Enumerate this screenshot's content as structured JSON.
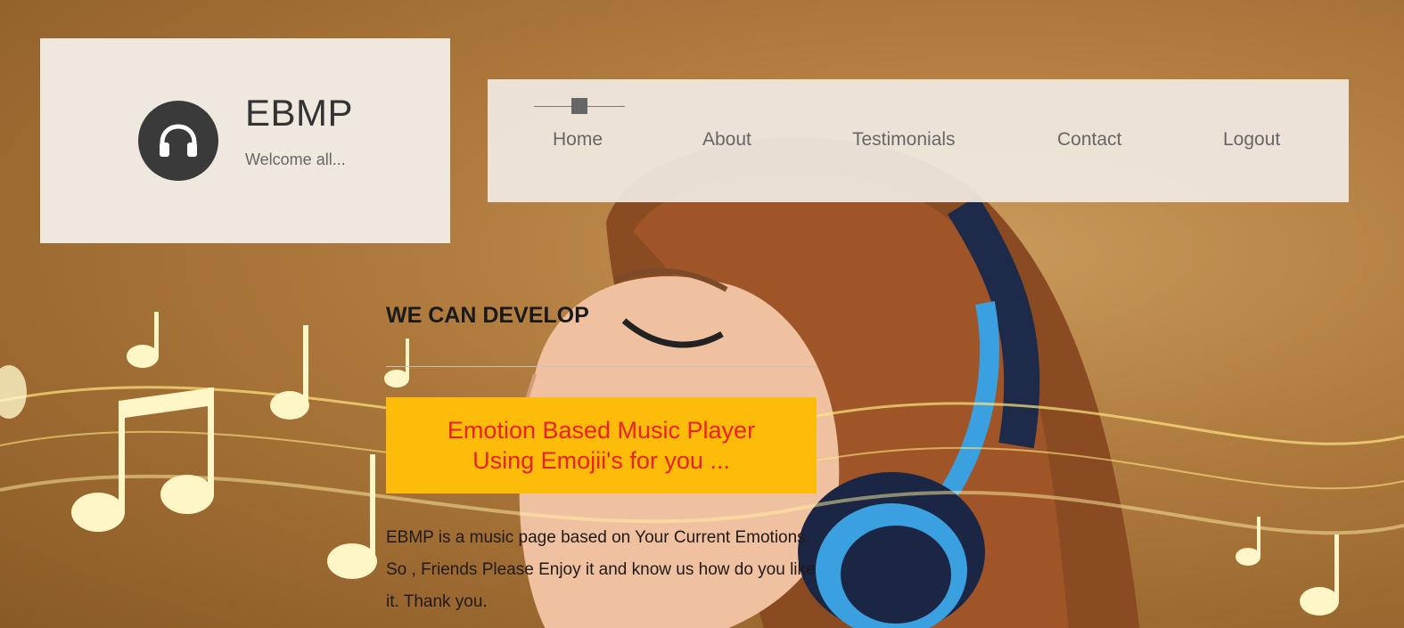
{
  "brand": {
    "title": "EBMP",
    "subtitle": "Welcome all...",
    "logo_icon": "headphones-icon"
  },
  "nav": {
    "items": [
      {
        "label": "Home"
      },
      {
        "label": "About"
      },
      {
        "label": "Testimonials"
      },
      {
        "label": "Contact"
      },
      {
        "label": "Logout"
      }
    ]
  },
  "hero": {
    "heading": "WE CAN DEVELOP",
    "callout": "Emotion Based Music Player Using Emojii's for you ...",
    "description": "EBMP is a music page based on Your Current Emotions. So , Friends Please Enjoy it and know us how do you like it. Thank you."
  },
  "colors": {
    "callout_bg": "#fdbb0a",
    "callout_text": "#e8231d",
    "panel_bg": "#efe8df",
    "logo_circle": "#3a3a3a"
  }
}
